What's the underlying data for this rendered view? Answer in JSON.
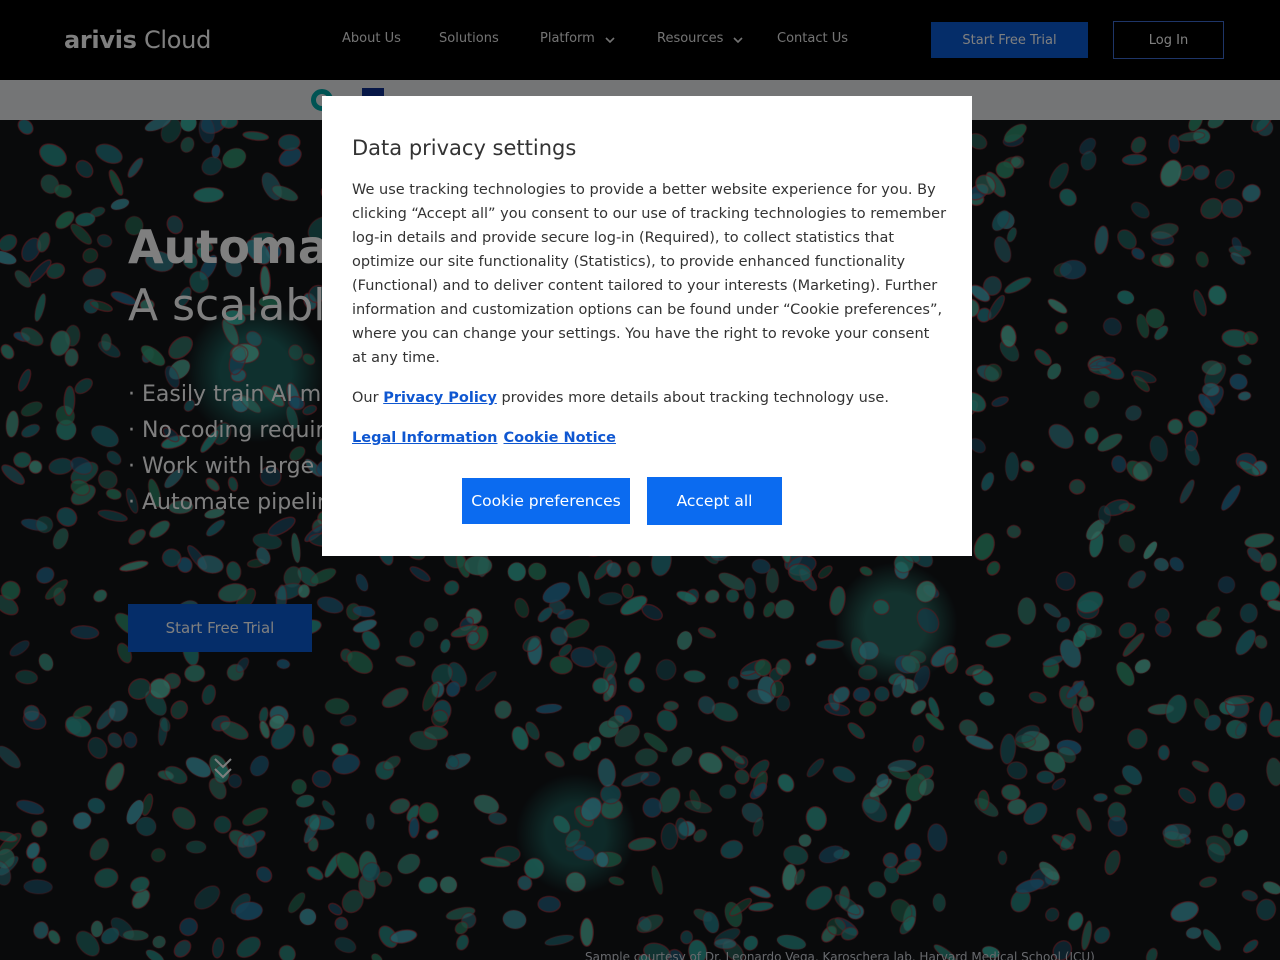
{
  "header": {
    "logo_bold": "arivis",
    "logo_light": " Cloud",
    "nav": {
      "about": "About Us",
      "solutions": "Solutions",
      "platform": "Platform",
      "resources": "Resources",
      "contact": "Contact Us"
    },
    "start_trial": "Start Free Trial",
    "login": "Log In"
  },
  "hero": {
    "title": "Automat",
    "subtitle": "A scalable",
    "bullets": [
      "· Easily train AI moc",
      "· No coding require",
      "· Work with large c",
      "· Automate pipeline"
    ],
    "cta": "Start Free Trial",
    "credit": "Sample courtesy of Dr. Leonardo Vega, Karoschera lab, Harvard Medical School (ICU)"
  },
  "modal": {
    "title": "Data privacy settings",
    "body": "We use tracking technologies to provide a better website experience for you. By clicking “Accept all” you consent to our use of tracking technologies to remember log-in details and provide secure log-in (Required), to collect statistics that optimize our site functionality (Statistics), to provide enhanced functionality (Functional) and to deliver content tailored to your interests (Marketing). Further information and customization options can be found under “Cookie preferences”, where you can change your settings. You have the right to revoke your consent at any time.",
    "policy_prefix": "Our ",
    "policy_link": "Privacy Policy",
    "policy_suffix": " provides more details about tracking technology use.",
    "legal_link": "Legal Information",
    "cookie_notice_link": "Cookie Notice",
    "btn_preferences": "Cookie preferences",
    "btn_accept": "Accept all"
  },
  "colors": {
    "primary_blue": "#0b6bf0",
    "header_bg": "#000000",
    "link_blue": "#0f57d1"
  }
}
